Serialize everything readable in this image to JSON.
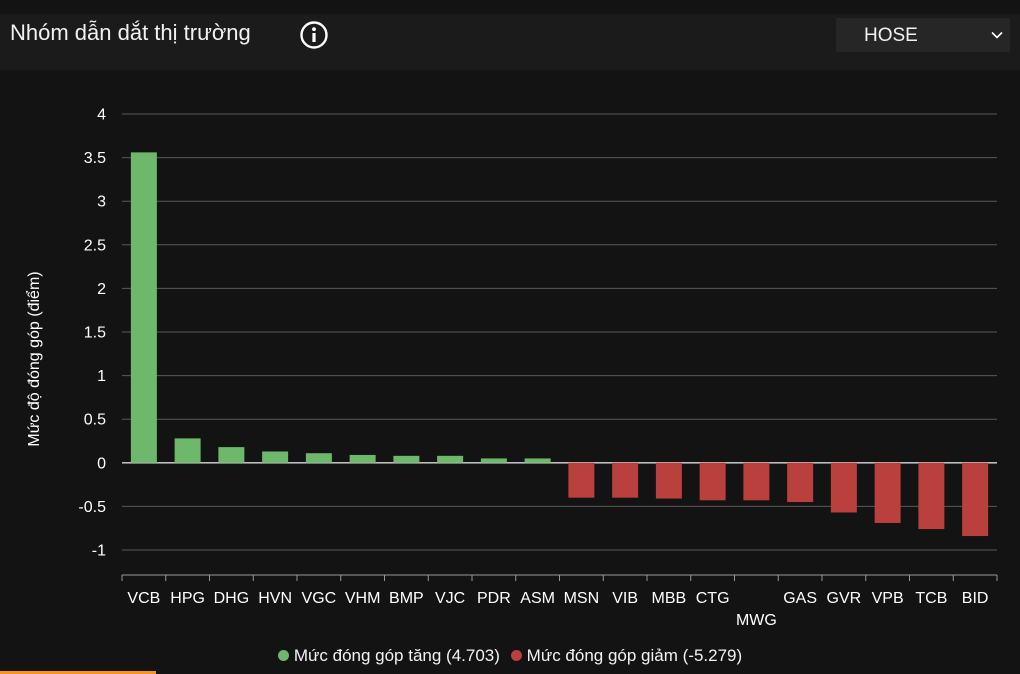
{
  "header": {
    "title": "Nhóm dẫn dắt thị trường",
    "info_icon": "info-circle-icon",
    "exchange_select": {
      "value": "HOSE",
      "icon": "chevron-down-icon"
    }
  },
  "colors": {
    "positive": "#6db86a",
    "negative": "#b9403d",
    "background": "#131313",
    "accent": "#f7931e"
  },
  "legend": {
    "increase_label": "Mức đóng góp tăng (4.703)",
    "decrease_label": "Mức đóng góp giảm (-5.279)"
  },
  "chart_data": {
    "type": "bar",
    "ylabel": "Mức độ đóng góp (điểm)",
    "ylim": [
      -1,
      4
    ],
    "y_ticks": [
      4,
      3.5,
      3,
      2.5,
      2,
      1.5,
      1,
      0.5,
      0,
      -0.5,
      -1
    ],
    "y_tick_labels": [
      "4",
      "3.5",
      "3",
      "2.5",
      "2",
      "1.5",
      "1",
      "0.5",
      "0",
      "-0.5",
      "-1"
    ],
    "grid": true,
    "legend_position": "bottom",
    "categories": [
      "VCB",
      "HPG",
      "DHG",
      "HVN",
      "VGC",
      "VHM",
      "BMP",
      "VJC",
      "PDR",
      "ASM",
      "MSN",
      "VIB",
      "MBB",
      "CTG",
      "MWG",
      "GAS",
      "GVR",
      "VPB",
      "TCB",
      "BID"
    ],
    "values": [
      3.56,
      0.28,
      0.18,
      0.13,
      0.11,
      0.09,
      0.08,
      0.08,
      0.05,
      0.05,
      -0.4,
      -0.4,
      -0.41,
      -0.43,
      -0.43,
      -0.45,
      -0.57,
      -0.69,
      -0.76,
      -0.84
    ]
  }
}
